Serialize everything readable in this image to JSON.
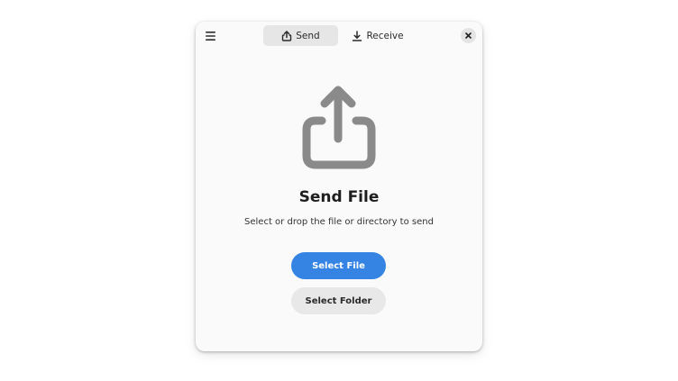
{
  "header": {
    "menu_icon": "hamburger-menu-icon",
    "tabs": [
      {
        "label": "Send",
        "icon": "share-upload-icon",
        "active": true
      },
      {
        "label": "Receive",
        "icon": "download-icon",
        "active": false
      }
    ],
    "close_icon": "close-icon"
  },
  "main": {
    "icon": "share-upload-icon",
    "icon_color": "#8a8a8a",
    "title": "Send File",
    "subtitle": "Select or drop the file or directory to send",
    "primary_button": {
      "label": "Select File",
      "color": "#3584e4"
    },
    "secondary_button": {
      "label": "Select Folder"
    }
  }
}
